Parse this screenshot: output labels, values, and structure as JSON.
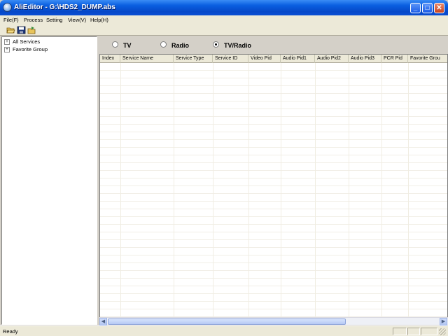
{
  "window": {
    "title": "AliEditor - G:\\HDS2_DUMP.abs"
  },
  "menu": {
    "items": [
      "File(F)",
      "Process",
      "Setting",
      "View(V)",
      "Help(H)"
    ]
  },
  "toolbar": {
    "buttons": [
      "open-folder-icon",
      "save-icon",
      "export-icon"
    ]
  },
  "tree": {
    "items": [
      "All Services",
      "Favorite Group"
    ]
  },
  "filter": {
    "options": [
      "TV",
      "Radio",
      "TV/Radio"
    ],
    "selected": "TV/Radio"
  },
  "table": {
    "columns": [
      "Index",
      "Service Name",
      "Service Type",
      "Service ID",
      "Video Pid",
      "Audio Pid1",
      "Audio Pid2",
      "Audio Pid3",
      "PCR Pid",
      "Favorite Grou"
    ],
    "rows": []
  },
  "status": {
    "text": "Ready"
  },
  "colors": {
    "titlebar": "#0a5fe0",
    "window_bg": "#d4d0c8",
    "list_bg": "#ffffff"
  }
}
